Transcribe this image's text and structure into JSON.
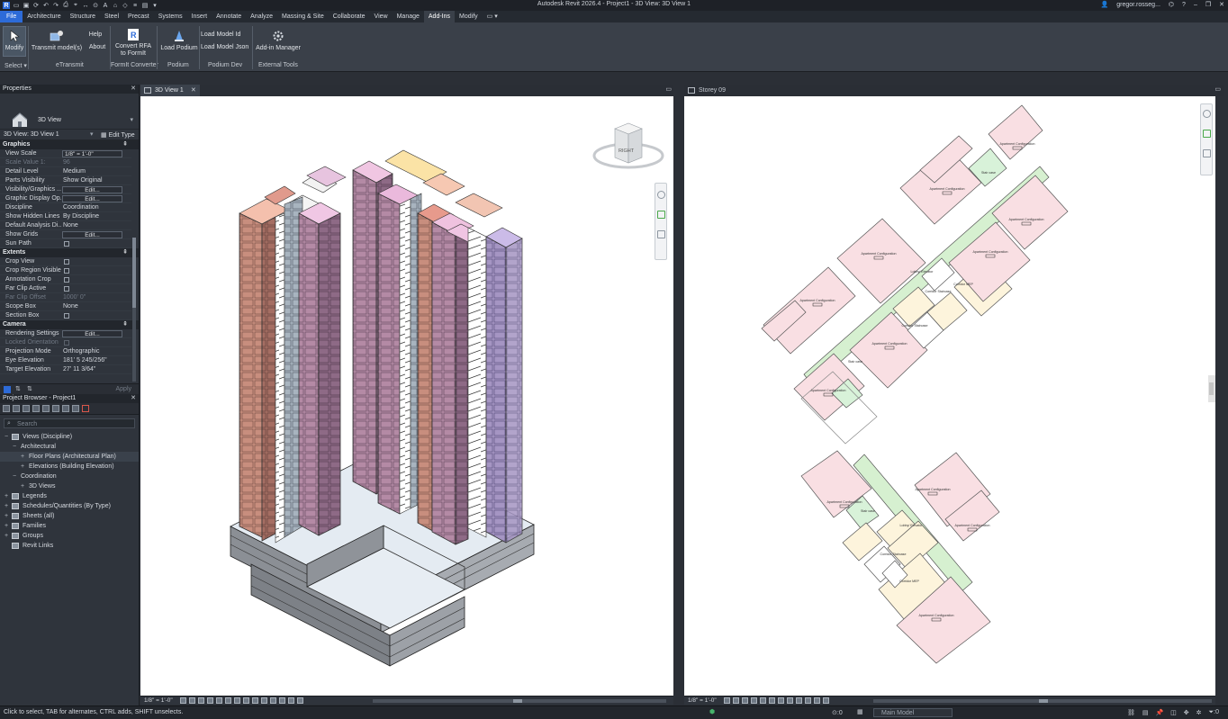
{
  "window": {
    "title": "Autodesk Revit 2026.4 - Project1 - 3D View: 3D View 1",
    "user": "gregor.rosseg...",
    "help": "?"
  },
  "menu": {
    "tabs": [
      "File",
      "Architecture",
      "Structure",
      "Steel",
      "Precast",
      "Systems",
      "Insert",
      "Annotate",
      "Analyze",
      "Massing & Site",
      "Collaborate",
      "View",
      "Manage",
      "Add-Ins",
      "Modify"
    ],
    "active": "Add-Ins"
  },
  "ribbon": {
    "modify": "Modify",
    "select": "Select ▾",
    "transmit": "Transmit model(s)",
    "help": "Help",
    "about": "About",
    "etransmit": "eTransmit",
    "convert_rfa_1": "Convert RFA",
    "convert_rfa_2": "to FormIt",
    "formit_converter": "FormIt Converter",
    "load_podium": "Load Podium",
    "podium": "Podium",
    "load_model_id": "Load Model Id",
    "load_model_json": "Load Model Json",
    "podium_dev": "Podium Dev",
    "addin_manager": "Add-in Manager",
    "external_tools": "External Tools"
  },
  "properties": {
    "title": "Properties",
    "type_name": "3D View",
    "instance": "3D View: 3D View 1",
    "edit_type": "Edit Type",
    "apply": "Apply",
    "categories": {
      "graphics": "Graphics",
      "extents": "Extents",
      "camera": "Camera"
    },
    "graphics_rows": [
      {
        "k": "View Scale",
        "v": "1/8\" = 1'-0\"",
        "kind": "field"
      },
      {
        "k": "Scale Value    1:",
        "v": "96",
        "kind": "dim"
      },
      {
        "k": "Detail Level",
        "v": "Medium",
        "kind": "text"
      },
      {
        "k": "Parts Visibility",
        "v": "Show Original",
        "kind": "text"
      },
      {
        "k": "Visibility/Graphics ...",
        "v": "Edit...",
        "kind": "button"
      },
      {
        "k": "Graphic Display Op...",
        "v": "Edit...",
        "kind": "button"
      },
      {
        "k": "Discipline",
        "v": "Coordination",
        "kind": "text"
      },
      {
        "k": "Show Hidden Lines",
        "v": "By Discipline",
        "kind": "text"
      },
      {
        "k": "Default Analysis Di...",
        "v": "None",
        "kind": "text"
      },
      {
        "k": "Show Grids",
        "v": "Edit...",
        "kind": "button"
      },
      {
        "k": "Sun Path",
        "v": "",
        "kind": "check"
      }
    ],
    "extents_rows": [
      {
        "k": "Crop View",
        "v": "",
        "kind": "check"
      },
      {
        "k": "Crop Region Visible",
        "v": "",
        "kind": "check"
      },
      {
        "k": "Annotation Crop",
        "v": "",
        "kind": "check"
      },
      {
        "k": "Far Clip Active",
        "v": "",
        "kind": "check"
      },
      {
        "k": "Far Clip Offset",
        "v": "1000'  0\"",
        "kind": "dim"
      },
      {
        "k": "Scope Box",
        "v": "None",
        "kind": "text"
      },
      {
        "k": "Section Box",
        "v": "",
        "kind": "check"
      }
    ],
    "camera_rows": [
      {
        "k": "Rendering Settings",
        "v": "Edit...",
        "kind": "button"
      },
      {
        "k": "Locked Orientation",
        "v": "",
        "kind": "checkdim"
      },
      {
        "k": "Projection Mode",
        "v": "Orthographic",
        "kind": "text"
      },
      {
        "k": "Eye Elevation",
        "v": "181'  5 245/256\"",
        "kind": "text"
      },
      {
        "k": "Target Elevation",
        "v": "27'  11 3/64\"",
        "kind": "text"
      }
    ]
  },
  "browser": {
    "title": "Project Browser - Project1",
    "search_placeholder": "Search",
    "nodes": [
      {
        "label": "Views (Discipline)",
        "indent": 0,
        "exp": "−",
        "icon": true
      },
      {
        "label": "Architectural",
        "indent": 1,
        "exp": "−",
        "icon": false
      },
      {
        "label": "Floor Plans (Architectural Plan)",
        "indent": 2,
        "exp": "+",
        "icon": false,
        "sel": true
      },
      {
        "label": "Elevations (Building Elevation)",
        "indent": 2,
        "exp": "+",
        "icon": false
      },
      {
        "label": "Coordination",
        "indent": 1,
        "exp": "−",
        "icon": false
      },
      {
        "label": "3D Views",
        "indent": 2,
        "exp": "+",
        "icon": false
      },
      {
        "label": "Legends",
        "indent": 0,
        "exp": "+",
        "icon": true
      },
      {
        "label": "Schedules/Quantities (By Type)",
        "indent": 0,
        "exp": "+",
        "icon": true
      },
      {
        "label": "Sheets (all)",
        "indent": 0,
        "exp": "+",
        "icon": true
      },
      {
        "label": "Families",
        "indent": 0,
        "exp": "+",
        "icon": true
      },
      {
        "label": "Groups",
        "indent": 0,
        "exp": "+",
        "icon": true
      },
      {
        "label": "Revit Links",
        "indent": 0,
        "exp": "",
        "icon": true
      }
    ]
  },
  "views": {
    "left_tab": "3D View 1",
    "right_tab": "Storey 09",
    "scale_left": "1/8\" = 1'-0\"",
    "scale_right": "1/8\" = 1'-0\"",
    "viewcube_face": "RIGHT"
  },
  "plan": {
    "apt_label": "Apartment Configuration",
    "apt_sub": "0000",
    "stair": "Stair case",
    "lobby": "Lobby/ Elevator",
    "corridor": "Corridor Staircase",
    "mep": "Corridor MEP"
  },
  "status": {
    "message": "Click to select, TAB for alternates, CTRL adds, SHIFT unselects.",
    "model": "Main Model",
    "zero": ":0",
    "filter_zero": ":0"
  },
  "colors": {
    "file_tab": "#2d6bd8",
    "apartment_fill": "#f9dfe3",
    "corridor_fill": "#d6f0d0",
    "core_fill": "#fdf4dc",
    "tower_terracotta": "#c98e7f",
    "tower_mauve": "#a48db8"
  }
}
